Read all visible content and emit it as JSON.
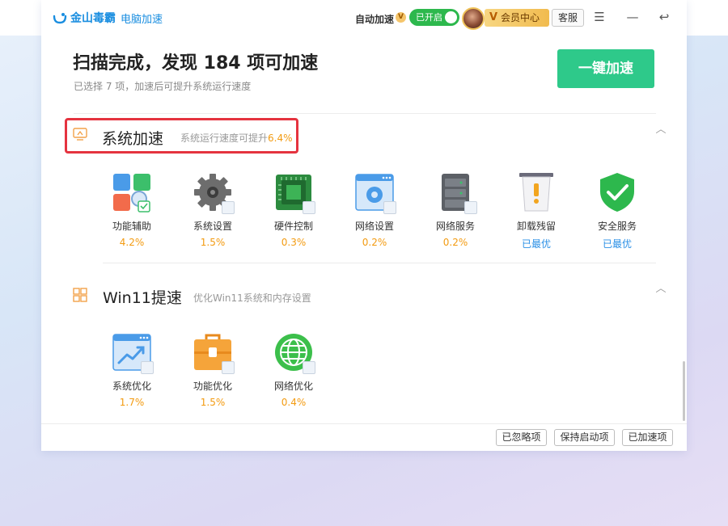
{
  "app": {
    "name": "金山毒霸",
    "module": "电脑加速"
  },
  "titlebar": {
    "auto_boost_label": "自动加速",
    "auto_boost_status": "已开启",
    "vip_label": "会员中心",
    "vip_letter": "V",
    "service_label": "客服",
    "menu_icon": "☰",
    "minimize_icon": "—",
    "back_icon": "↩"
  },
  "header": {
    "title": "扫描完成，发现 184 项可加速",
    "subtitle": "已选择 7 项，加速后可提升系统运行速度",
    "boost_button": "一键加速"
  },
  "sections": [
    {
      "title": "系统加速",
      "desc": "系统运行速度可提升",
      "desc_highlight": "6.4%",
      "items": [
        {
          "name": "功能辅助",
          "value": "4.2%",
          "icon": "app-grid-icon"
        },
        {
          "name": "系统设置",
          "value": "1.5%",
          "icon": "gear-icon"
        },
        {
          "name": "硬件控制",
          "value": "0.3%",
          "icon": "chip-icon"
        },
        {
          "name": "网络设置",
          "value": "0.2%",
          "icon": "network-gear-icon"
        },
        {
          "name": "网络服务",
          "value": "0.2%",
          "icon": "server-icon"
        },
        {
          "name": "卸载残留",
          "value": "已最优",
          "icon": "trash-warning-icon"
        },
        {
          "name": "安全服务",
          "value": "已最优",
          "icon": "shield-check-icon"
        }
      ]
    },
    {
      "title": "Win11提速",
      "desc": "优化Win11系统和内存设置",
      "items": [
        {
          "name": "系统优化",
          "value": "1.7%",
          "icon": "trend-chart-icon"
        },
        {
          "name": "功能优化",
          "value": "1.5%",
          "icon": "toolbox-icon"
        },
        {
          "name": "网络优化",
          "value": "0.4%",
          "icon": "globe-icon"
        }
      ]
    }
  ],
  "footer": {
    "ignored": "已忽略项",
    "keep_startup": "保持启动项",
    "boosted": "已加速项"
  },
  "colors": {
    "accent_blue": "#1a8ee0",
    "boost_green": "#2ec98a",
    "highlight_orange": "#f39b11",
    "optimal_blue": "#2a8fe6",
    "annotation_red": "#e5333f"
  }
}
